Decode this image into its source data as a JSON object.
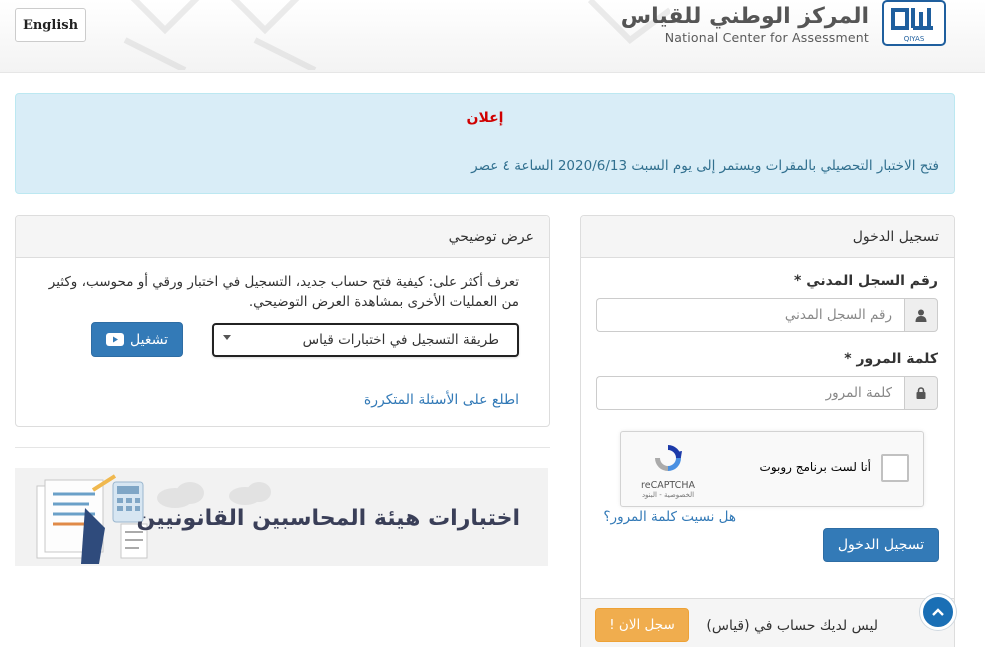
{
  "header": {
    "english_label": "English",
    "logo_ar": "المركز الوطني للقياس",
    "logo_en": "National Center for Assessment",
    "logo_mark_text": "QIYAS"
  },
  "announcement": {
    "title": "إعلان",
    "text": "فتح الاختبار التحصيلي بالمقرات ويستمر  إلى يوم السبت 2020/6/13 الساعة ٤ عصر"
  },
  "login": {
    "title": "تسجيل الدخول",
    "id_label": "رقم السجل المدني *",
    "id_placeholder": "رقم السجل المدني",
    "password_label": "كلمة المرور *",
    "password_placeholder": "كلمة المرور",
    "recaptcha_label": "أنا لست برنامج روبوت",
    "recaptcha_brand": "reCAPTCHA",
    "recaptcha_terms": "الخصوصية - البنود",
    "forgot_link": "هل نسيت كلمة المرور؟",
    "submit_label": "تسجيل الدخول",
    "no_account_text": "ليس لديك حساب في (قياس)",
    "register_label": "سجل الان !"
  },
  "demo": {
    "title": "عرض توضيحي",
    "description": "تعرف أكثر على: كيفية فتح حساب جديد، التسجيل في اختبار ورقي أو محوسب، وكثير من العمليات الأخرى بمشاهدة العرض التوضيحي.",
    "selected_option": "طريقة التسجيل في اختبارات قياس",
    "play_label": "تشغيل",
    "faq_link": "اطلع على الأسئلة المتكررة"
  },
  "banner": {
    "title": "اختبارات هيئة المحاسبين القانونيين"
  },
  "colors": {
    "primary": "#337ab7",
    "warning": "#f0ad4e",
    "announce_bg": "#d9edf7",
    "announce_title": "#d00000"
  }
}
